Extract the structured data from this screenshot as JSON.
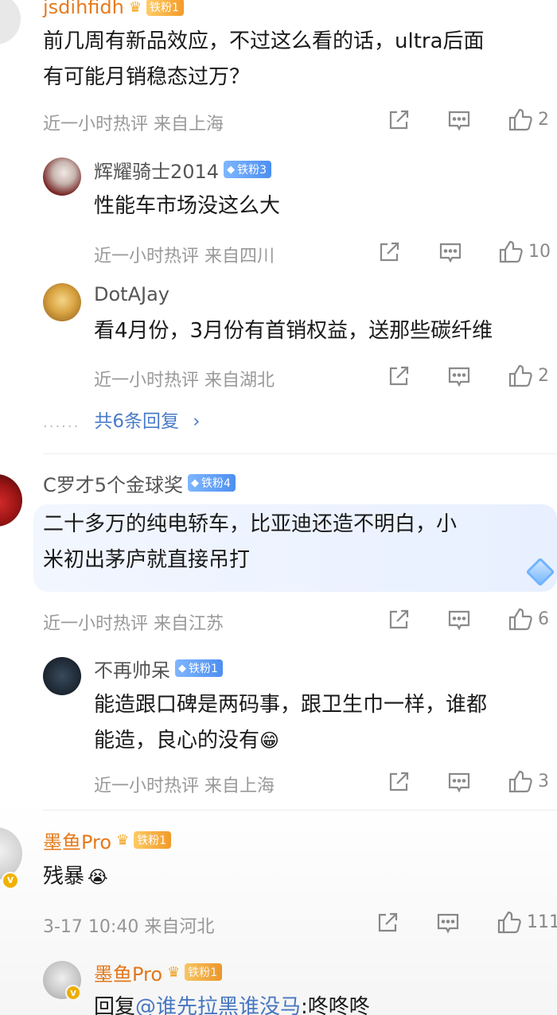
{
  "comments": [
    {
      "username": "jsdihfidh",
      "badge": "铁粉1",
      "text_lines": [
        "前几周有新品效应，不过这么看的话，ultra后面",
        "有可能月销稳态过万？"
      ],
      "meta": "近一小时热评  来自上海",
      "likes": "2"
    },
    {
      "username": "辉耀骑士2014",
      "badge": "铁粉3",
      "text_lines": [
        "性能车市场没这么大"
      ],
      "meta": "近一小时热评  来自四川",
      "likes": "10"
    },
    {
      "username": "DotAJay",
      "text_lines": [
        "看4月份，3月份有首销权益，送那些碳纤维"
      ],
      "meta": "近一小时热评  来自湖北",
      "likes": "2"
    },
    {
      "username": "C罗才5个金球奖",
      "badge": "铁粉4",
      "text_lines": [
        "二十多万的纯电轿车，比亚迪还造不明白，小",
        "米初出茅庐就直接吊打"
      ],
      "meta": "近一小时热评  来自江苏",
      "likes": "6"
    },
    {
      "username": "不再帅呆",
      "badge": "铁粉1",
      "text_lines": [
        "能造跟口碑是两码事，跟卫生巾一样，谁都",
        "能造，良心的没有"
      ],
      "meta": "近一小时热评  来自上海",
      "likes": "3"
    },
    {
      "username": "墨鱼Pro",
      "badge": "铁粉1",
      "text_lines": [
        "残暴"
      ],
      "meta": "3-17 10:40  来自河北",
      "likes": "111"
    },
    {
      "username": "墨鱼Pro",
      "badge": "铁粉1",
      "reply_prefix": "回复",
      "reply_mention": "@谁先拉黑谁没马",
      "reply_rest": ":咚咚咚"
    }
  ],
  "more_replies": "共6条回复",
  "more_arrow": "›",
  "more_dots": "......",
  "emoji_grin": "😁",
  "emoji_cry": "😭",
  "colors": {
    "link": "#4a7bc8",
    "vip_name": "#e87b1c",
    "badge_blue": "#4d8ff0",
    "badge_gold": "#f39b2a"
  },
  "icons": [
    "share-icon",
    "comment-icon",
    "like-icon",
    "crown-icon",
    "diamond-icon",
    "chevron-right-icon"
  ]
}
